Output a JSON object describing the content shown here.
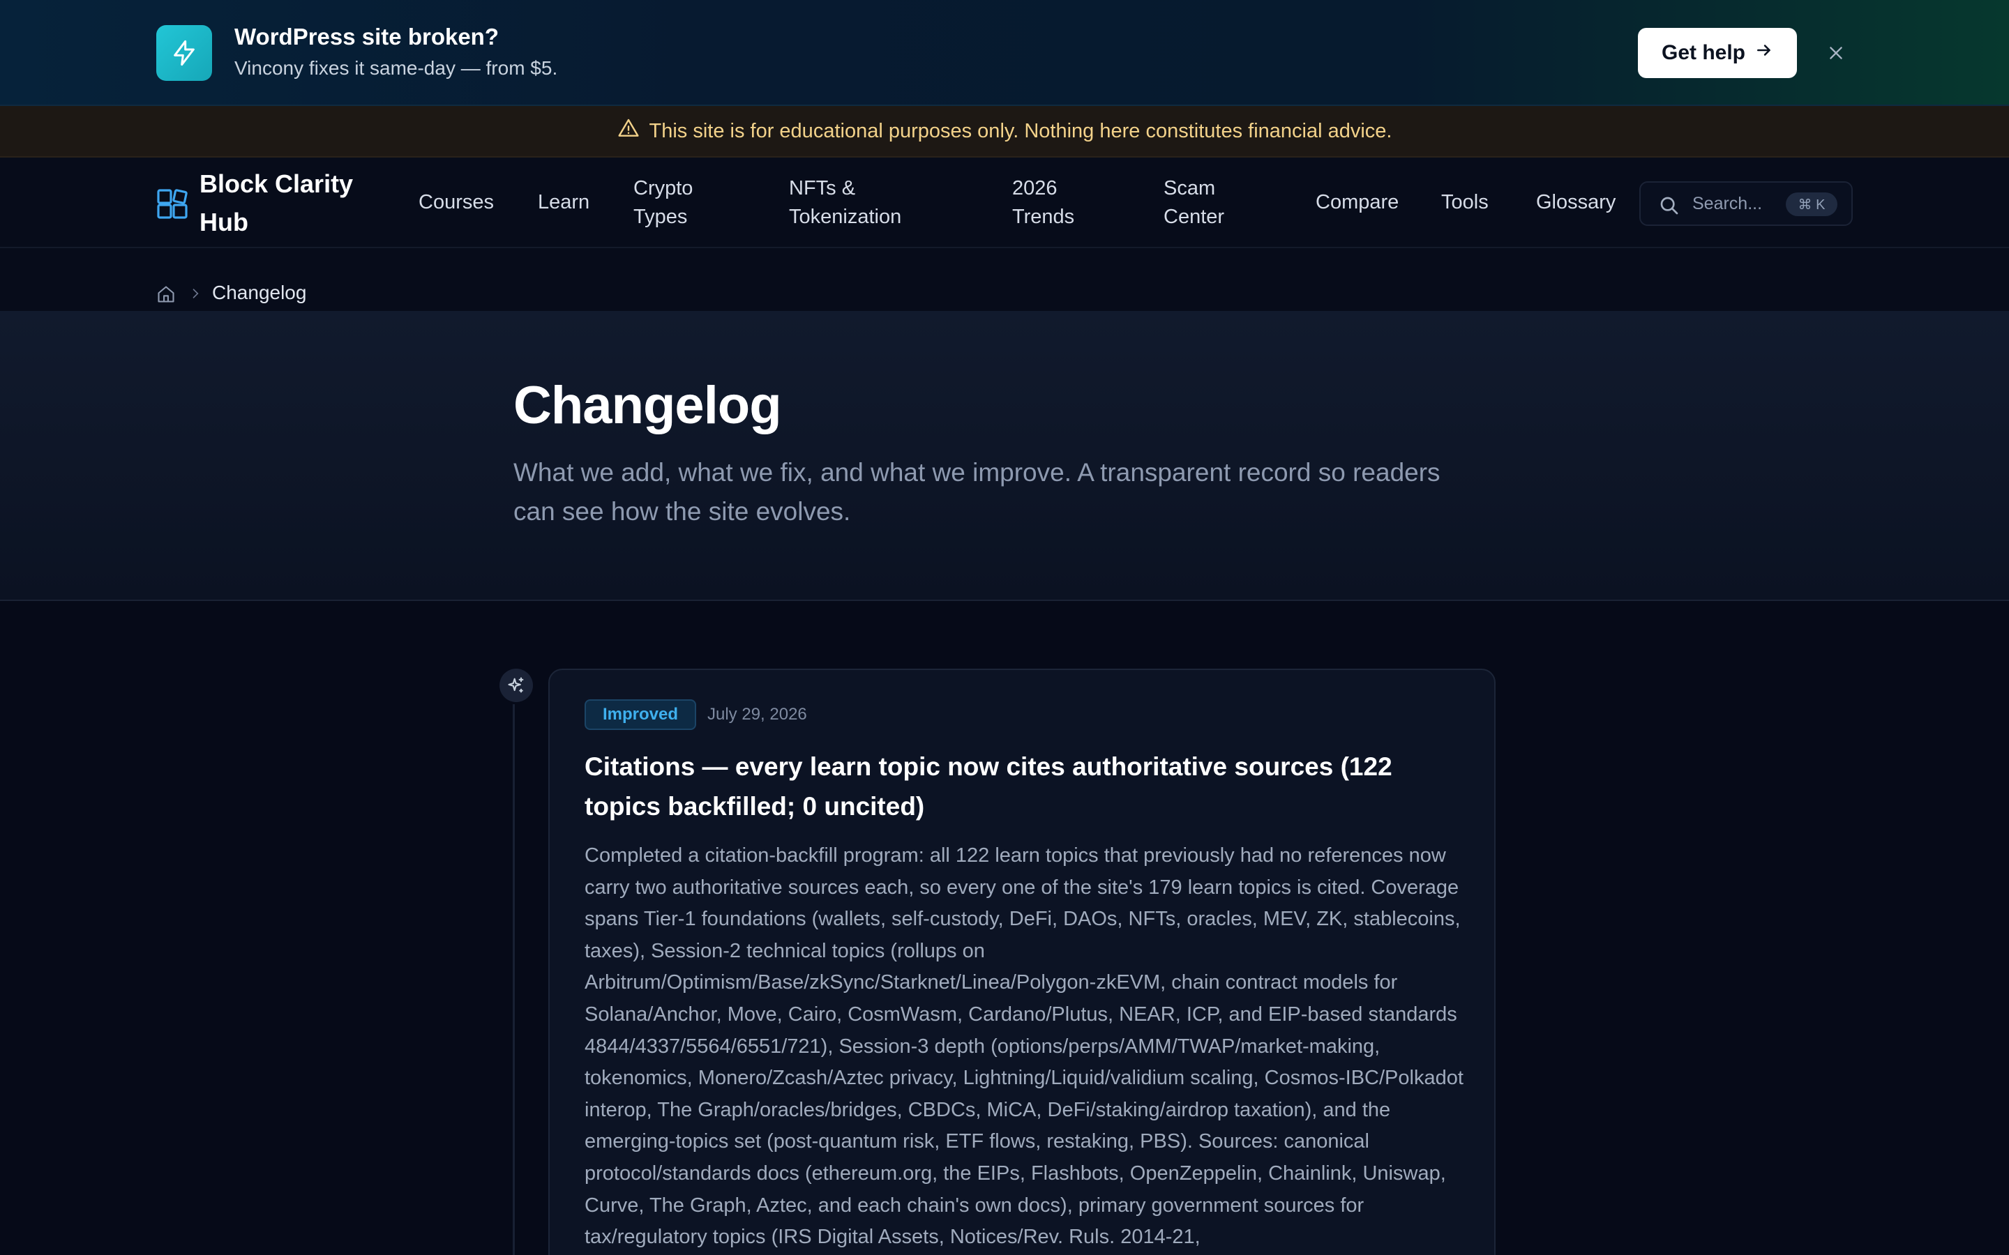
{
  "promo": {
    "title": "WordPress site broken?",
    "subtitle": "Vincony fixes it same-day — from $5.",
    "cta_label": "Get help",
    "icon": "lightning-bolt-icon",
    "accent": "#22c6d6"
  },
  "disclaimer": {
    "text": "This site is for educational purposes only. Nothing here constitutes financial advice.",
    "icon": "warning-triangle-icon",
    "color": "#f3d28a"
  },
  "nav": {
    "brand_line1": "Block Clarity",
    "brand_line2": "Hub",
    "items": [
      {
        "line1": "Courses",
        "line2": ""
      },
      {
        "line1": "Learn",
        "line2": ""
      },
      {
        "line1": "Crypto",
        "line2": "Types"
      },
      {
        "line1": "NFTs &",
        "line2": "Tokenization"
      },
      {
        "line1": "2026",
        "line2": "Trends"
      },
      {
        "line1": "Scam",
        "line2": "Center"
      },
      {
        "line1": "Compare",
        "line2": ""
      },
      {
        "line1": "Tools",
        "line2": ""
      },
      {
        "line1": "Glossary",
        "line2": ""
      }
    ],
    "search_placeholder": "Search...",
    "search_shortcut": "⌘ K"
  },
  "breadcrumb": {
    "current": "Changelog"
  },
  "hero": {
    "title": "Changelog",
    "subtitle": "What we add, what we fix, and what we improve. A transparent record so readers can see how the site evolves."
  },
  "entries": [
    {
      "badge": "Improved",
      "badge_color": "#3fb0ee",
      "date": "July 29, 2026",
      "title": "Citations — every learn topic now cites authoritative sources (122 topics backfilled; 0 uncited)",
      "body": "Completed a citation-backfill program: all 122 learn topics that previously had no references now carry two authoritative sources each, so every one of the site's 179 learn topics is cited. Coverage spans Tier-1 foundations (wallets, self-custody, DeFi, DAOs, NFTs, oracles, MEV, ZK, stablecoins, taxes), Session-2 technical topics (rollups on Arbitrum/Optimism/Base/zkSync/Starknet/Linea/Polygon-zkEVM, chain contract models for Solana/Anchor, Move, Cairo, CosmWasm, Cardano/Plutus, NEAR, ICP, and EIP-based standards 4844/4337/5564/6551/721), Session-3 depth (options/perps/AMM/TWAP/market-making, tokenomics, Monero/Zcash/Aztec privacy, Lightning/Liquid/validium scaling, Cosmos-IBC/Polkadot interop, The Graph/oracles/bridges, CBDCs, MiCA, DeFi/staking/airdrop taxation), and the emerging-topics set (post-quantum risk, ETF flows, restaking, PBS). Sources: canonical protocol/standards docs (ethereum.org, the EIPs, Flashbots, OpenZeppelin, Chainlink, Uniswap, Curve, The Graph, Aztec, and each chain's own docs), primary government sources for tax/regulatory topics (IRS Digital Assets, Notices/Rev. Ruls. 2014-21,"
    }
  ]
}
